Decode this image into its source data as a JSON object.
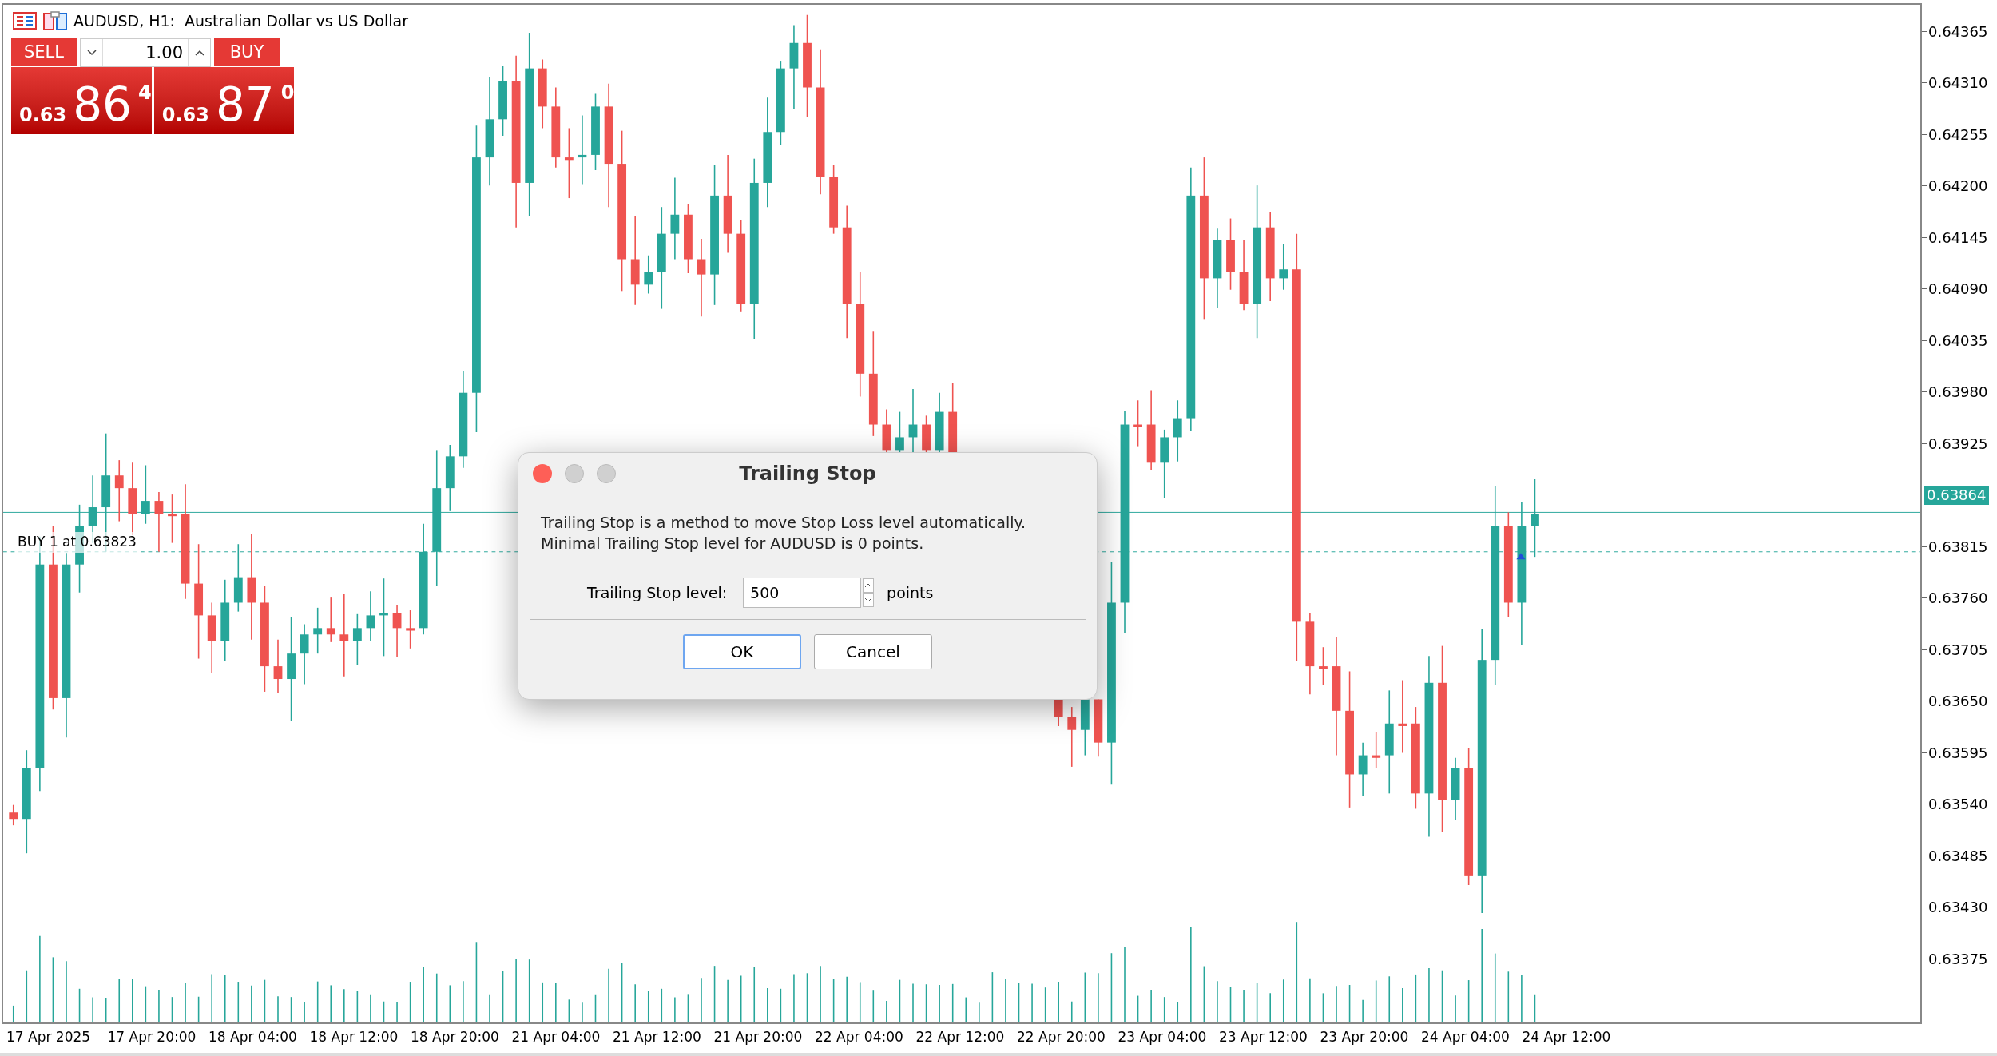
{
  "window": {
    "title": "AUDUSD, H1:  Australian Dollar vs US Dollar"
  },
  "trade_panel": {
    "sell_label": "SELL",
    "buy_label": "BUY",
    "volume": "1.00",
    "sell_price": {
      "prefix": "0.63",
      "big": "86",
      "sup": "4"
    },
    "buy_price": {
      "prefix": "0.63",
      "big": "87",
      "sup": "0"
    }
  },
  "position_label": "BUY 1 at 0.63823",
  "price_axis": {
    "ticks_above": [
      "0.64365",
      "0.64310",
      "0.64255",
      "0.64200",
      "0.64145",
      "0.64090",
      "0.64035",
      "0.63980",
      "0.63925"
    ],
    "current_price": "0.63864",
    "ticks_below": [
      "0.63815",
      "0.63760",
      "0.63705",
      "0.63650",
      "0.63595",
      "0.63540",
      "0.63485",
      "0.63430",
      "0.63375"
    ]
  },
  "time_axis": {
    "labels": [
      "17 Apr 2025",
      "17 Apr 20:00",
      "18 Apr 04:00",
      "18 Apr 12:00",
      "18 Apr 20:00",
      "21 Apr 04:00",
      "21 Apr 12:00",
      "21 Apr 20:00",
      "22 Apr 04:00",
      "22 Apr 12:00",
      "22 Apr 20:00",
      "23 Apr 04:00",
      "23 Apr 12:00",
      "23 Apr 20:00",
      "24 Apr 04:00",
      "24 Apr 12:00"
    ]
  },
  "dialog": {
    "title": "Trailing Stop",
    "description": [
      "Trailing Stop is a method to move Stop Loss level automatically.",
      "Minimal Trailing Stop level for AUDUSD is 0 points."
    ],
    "field_label": "Trailing Stop level:",
    "field_value": "500",
    "unit": "points",
    "buttons": [
      {
        "label": "OK",
        "default": true
      },
      {
        "label": "Cancel",
        "default": false
      }
    ]
  }
}
